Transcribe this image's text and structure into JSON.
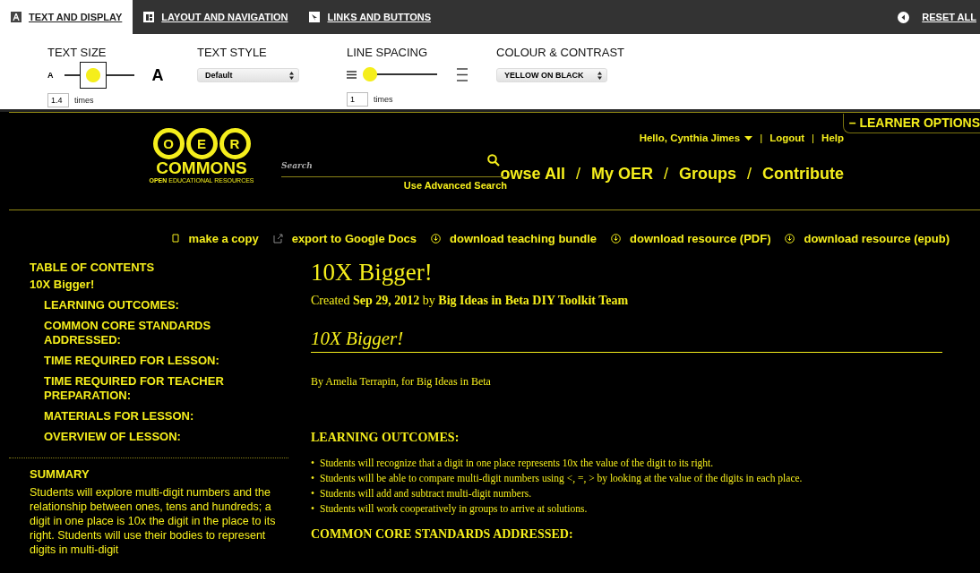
{
  "settings_tabs": [
    {
      "label": "TEXT AND DISPLAY",
      "kind": "letter",
      "selected": true
    },
    {
      "label": "LAYOUT AND NAVIGATION",
      "kind": "layout",
      "selected": false
    },
    {
      "label": "LINKS AND BUTTONS",
      "kind": "cursor",
      "selected": false
    }
  ],
  "reset": {
    "label": "RESET ALL"
  },
  "text_size": {
    "title": "TEXT SIZE",
    "small_glyph": "A",
    "large_glyph": "A",
    "level": 0.42,
    "value": "1.4",
    "unit": "times"
  },
  "text_style": {
    "title": "TEXT STYLE",
    "value": "Default"
  },
  "line_spacing": {
    "title": "LINE SPACING",
    "level": 0.08,
    "value": "1",
    "unit": "times"
  },
  "colour_contrast": {
    "title": "COLOUR & CONTRAST",
    "value": "YELLOW ON BLACK"
  },
  "learner_options": {
    "label": "– LEARNER OPTIONS"
  },
  "logo": {
    "letters": [
      "O",
      "E",
      "R"
    ],
    "name": "COMMONS",
    "tagline": "**OPEN** EDUCATIONAL RESOURCES"
  },
  "search": {
    "placeholder": "Search",
    "advanced": "Use Advanced Search"
  },
  "user_menu": [
    {
      "kind": "menu",
      "text": "Hello,  Cynthia Jimes"
    },
    {
      "kind": "separator",
      "text": "|"
    },
    {
      "kind": "link",
      "text": "Logout"
    },
    {
      "kind": "separator",
      "text": "|"
    },
    {
      "kind": "link",
      "text": "Help"
    }
  ],
  "main_nav": [
    {
      "kind": "link",
      "text": "owse All"
    },
    {
      "kind": "separator",
      "text": "/"
    },
    {
      "kind": "link",
      "text": "My OER"
    },
    {
      "kind": "separator",
      "text": "/"
    },
    {
      "kind": "link",
      "text": "Groups"
    },
    {
      "kind": "separator",
      "text": "/"
    },
    {
      "kind": "link",
      "text": "Contribute"
    }
  ],
  "actions": [
    {
      "label": "make a copy",
      "kind": "copy"
    },
    {
      "label": "export to Google Docs",
      "kind": "external"
    },
    {
      "label": "download teaching bundle",
      "kind": "download"
    },
    {
      "label": "download resource (PDF)",
      "kind": "download"
    },
    {
      "label": "download resource (epub)",
      "kind": "download"
    }
  ],
  "toc": {
    "title": "TABLE OF CONTENTS",
    "items": [
      {
        "label": "10X Bigger!",
        "children": [
          {
            "label": "LEARNING OUTCOMES:"
          },
          {
            "label": "COMMON CORE STANDARDS ADDRESSED:"
          },
          {
            "label": "TIME REQUIRED FOR LESSON:"
          },
          {
            "label": "TIME REQUIRED FOR TEACHER PREPARATION:"
          },
          {
            "label": "MATERIALS FOR LESSON:"
          },
          {
            "label": "OVERVIEW OF LESSON:"
          }
        ]
      }
    ]
  },
  "summary": {
    "title": "SUMMARY",
    "text": "Students will explore multi-digit numbers and the relationship between ones, tens and hundreds; a digit in one place is 10x the digit in the place to its right. Students will use their bodies to represent digits in multi-digit"
  },
  "article": {
    "title": "10X Bigger!",
    "byline": "Created **Sep 29, 2012** by **Big Ideas in Beta DIY Toolkit Team**",
    "subtitle": "10X Bigger!",
    "author": "By Amelia Terrapin, for Big Ideas in Beta",
    "sections": [
      {
        "heading": "LEARNING OUTCOMES:",
        "bullets": [
          {
            "marker": "•",
            "text": "Students will recognize that a digit in one place represents 10x the value of the digit to its right."
          },
          {
            "marker": "•",
            "text": "Students will be able to compare multi-digit numbers using <, =, > by looking at the value of the digits in each place."
          },
          {
            "marker": "•",
            "text": "Students will add and subtract multi-digit numbers."
          },
          {
            "marker": "•",
            "text": "Students will work cooperatively in groups to arrive at solutions."
          }
        ]
      },
      {
        "heading": "COMMON CORE STANDARDS ADDRESSED:"
      }
    ]
  }
}
